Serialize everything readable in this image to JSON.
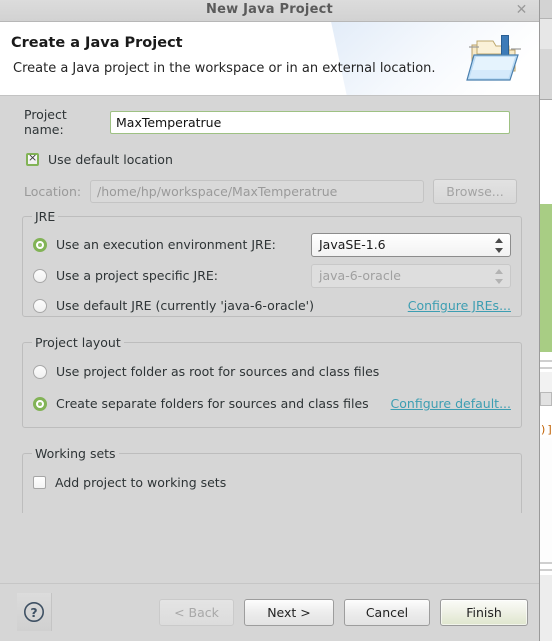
{
  "window": {
    "title": "New Java Project",
    "close_icon": "close-icon"
  },
  "header": {
    "title": "Create a Java Project",
    "description": "Create a Java project in the workspace or in an external location.",
    "icon": "java-project-folder-icon"
  },
  "project_name": {
    "label": "Project name:",
    "value": "MaxTemperatrue"
  },
  "default_location": {
    "label": "Use default location",
    "checked": true
  },
  "location": {
    "label": "Location:",
    "value": "/home/hp/workspace/MaxTemperatrue",
    "browse_label": "Browse...",
    "enabled": false
  },
  "jre": {
    "group_title": "JRE",
    "options": [
      {
        "label": "Use an execution environment JRE:",
        "selected": true
      },
      {
        "label": "Use a project specific JRE:",
        "selected": false
      },
      {
        "label": "Use default JRE (currently 'java-6-oracle')",
        "selected": false
      }
    ],
    "execution_environment_value": "JavaSE-1.6",
    "project_specific_value": "java-6-oracle",
    "configure_link": "Configure JREs..."
  },
  "project_layout": {
    "group_title": "Project layout",
    "options": [
      {
        "label": "Use project folder as root for sources and class files",
        "selected": false
      },
      {
        "label": "Create separate folders for sources and class files",
        "selected": true
      }
    ],
    "configure_link": "Configure default..."
  },
  "working_sets": {
    "group_title": "Working sets",
    "add_label": "Add project to working sets",
    "checked": false
  },
  "buttons": {
    "help": "?",
    "back": "< Back",
    "next": "Next >",
    "cancel": "Cancel",
    "finish": "Finish"
  },
  "background": {
    "code_fragment": ")]"
  },
  "colors": {
    "accent_green": "#82b356",
    "link_teal": "#3d9eb2",
    "dialog_bg": "#d6d6d6",
    "header_bg": "#ffffff",
    "highlight_green": "#a8cd84"
  }
}
